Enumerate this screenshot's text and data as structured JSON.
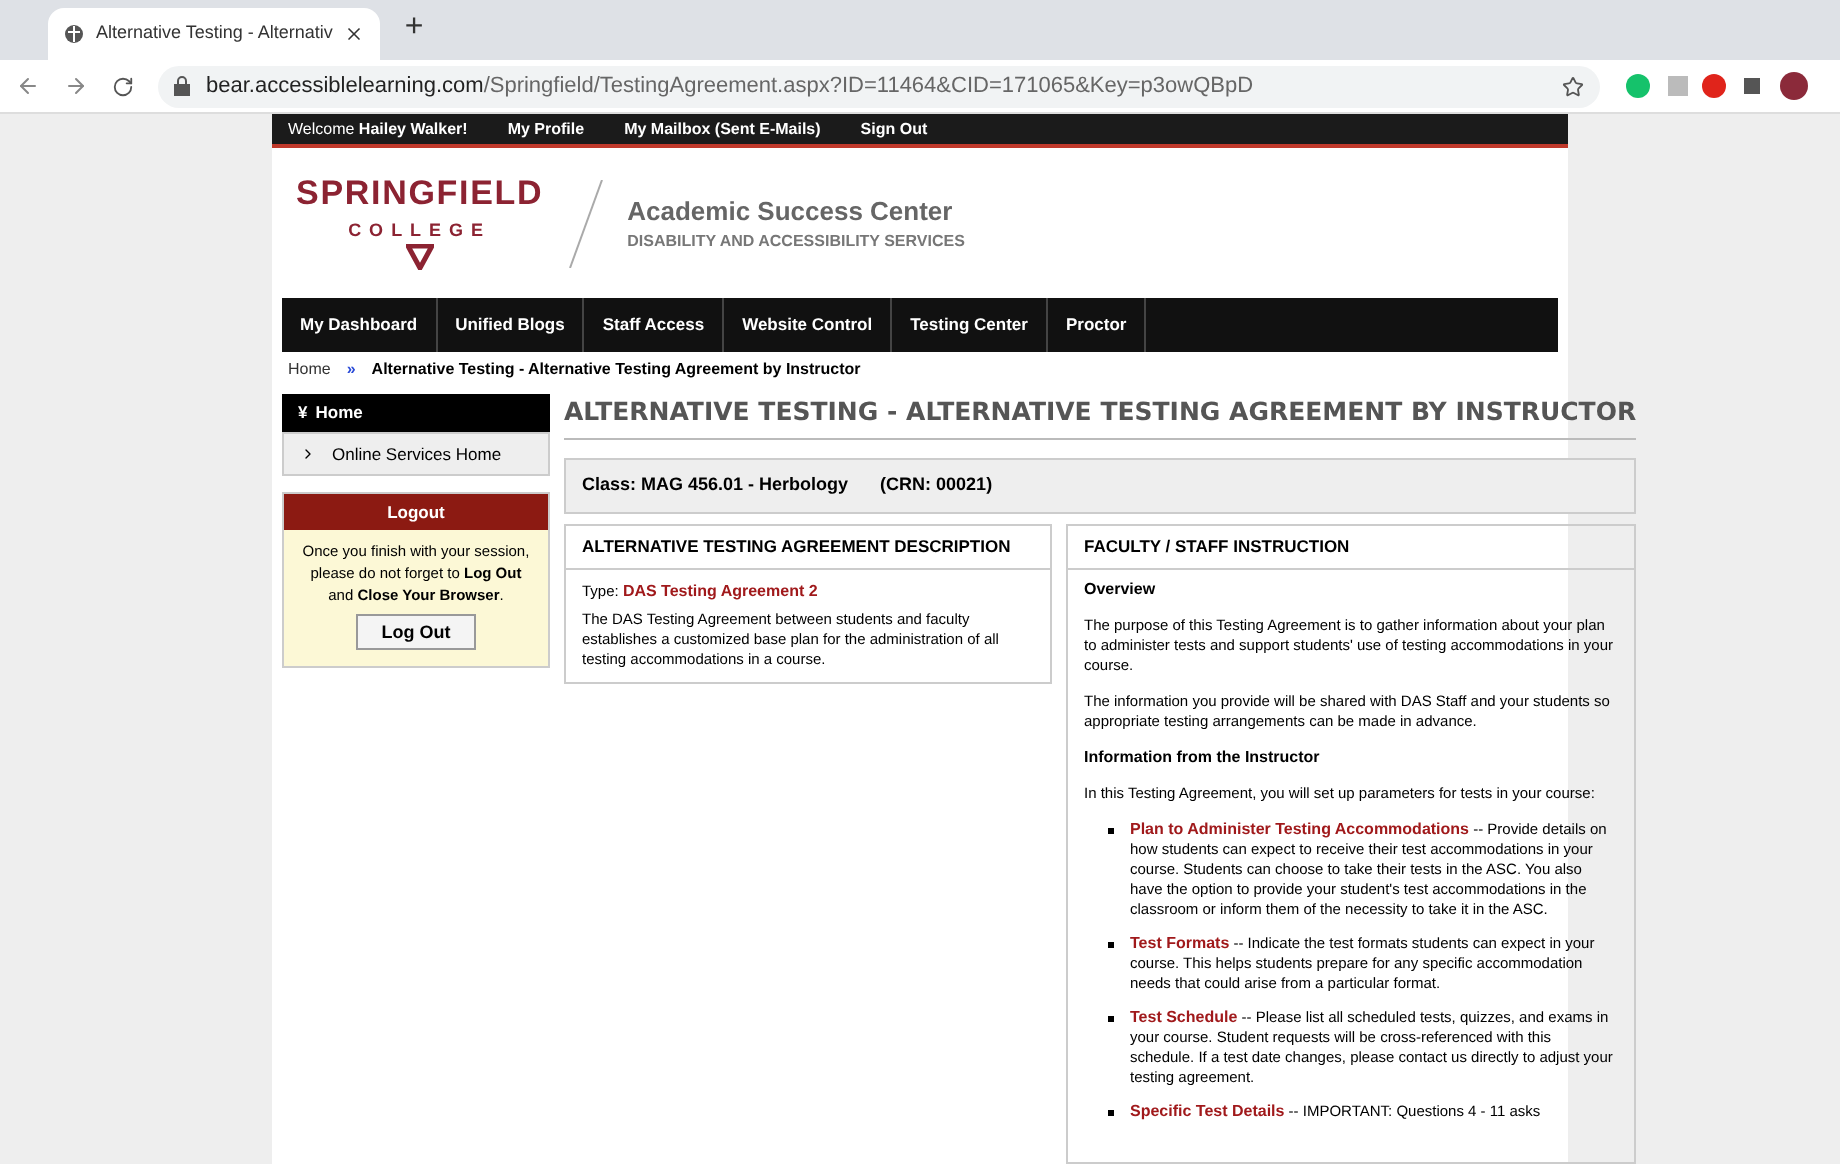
{
  "browser": {
    "tab_title": "Alternative Testing - Alternativ",
    "new_tab": "+",
    "url_host": "bear.accessiblelearning.com",
    "url_path": "/Springfield/TestingAgreement.aspx?ID=11464&CID=171065&Key=p3owQBpD"
  },
  "top_bar": {
    "welcome": "Welcome **Hailey Walker!**",
    "links": [
      "My Profile",
      "My Mailbox (Sent E-Mails)",
      "Sign Out"
    ]
  },
  "header": {
    "logo_main": "SPRINGFIELD",
    "logo_sub": "COLLEGE",
    "title": "Academic Success Center",
    "subtitle": "DISABILITY AND ACCESSIBILITY SERVICES"
  },
  "nav": [
    {
      "label": "My Dashboard"
    },
    {
      "label": "Unified Blogs"
    },
    {
      "label": "Staff Access"
    },
    {
      "label": "Website Control"
    },
    {
      "label": "Testing Center"
    },
    {
      "label": "Proctor"
    }
  ],
  "breadcrumb": {
    "home": "Home",
    "separator": "»",
    "current": "Alternative Testing - Alternative Testing Agreement by Instructor"
  },
  "sidebar": {
    "heading_icon": "¥",
    "heading": "Home",
    "items": [
      {
        "label": "Online Services Home"
      }
    ],
    "logout": {
      "title": "Logout",
      "message": "Once you finish with your session, please do not forget to **Log Out** and **Close Your Browser**.",
      "button": "Log Out"
    }
  },
  "page_title": "ALTERNATIVE TESTING - ALTERNATIVE TESTING AGREEMENT BY INSTRUCTOR",
  "class_line": {
    "class": "Class: MAG 456.01 - Herbology",
    "crn": "(CRN: 00021)"
  },
  "description": {
    "title": "ALTERNATIVE TESTING AGREEMENT DESCRIPTION",
    "type_label": "Type:",
    "type_value": "DAS Testing Agreement 2",
    "text": "The DAS Testing Agreement between students and faculty establishes a customized base plan for the administration of all testing accommodations in a course."
  },
  "instruction": {
    "title": "FACULTY / STAFF INSTRUCTION",
    "blocks": [
      {
        "kind": "heading",
        "text": "Overview"
      },
      {
        "kind": "paragraph",
        "text": "The purpose of this Testing Agreement is to gather information about your plan to administer tests and support students' use of testing accommodations in your course."
      },
      {
        "kind": "paragraph",
        "text": "The information you provide will be shared with DAS Staff and your students so appropriate testing arrangements can be made in advance."
      },
      {
        "kind": "heading",
        "text": "Information from the Instructor"
      },
      {
        "kind": "paragraph",
        "text": "In this Testing Agreement, you will set up parameters for tests in your course:"
      }
    ],
    "bullets": [
      {
        "term": "Plan to Administer Testing Accommodations",
        "text": " -- Provide details on how students can expect to receive their test accommodations in your course. Students can choose to take their tests in the ASC. You also have the option to provide your student's test accommodations in the classroom or inform them of the necessity to take it in the ASC."
      },
      {
        "term": "Test Formats",
        "text": " -- Indicate the test formats students can expect in your course. This helps students prepare for any specific accommodation needs that could arise from a particular format."
      },
      {
        "term": "Test Schedule",
        "text": " -- Please list all scheduled tests, quizzes, and exams in your course. Student requests will be cross-referenced with this schedule. If a test date changes, please contact us directly to adjust your testing agreement."
      },
      {
        "term": "Specific Test Details",
        "text": " -- IMPORTANT: Questions 4 - 11 asks"
      }
    ]
  }
}
